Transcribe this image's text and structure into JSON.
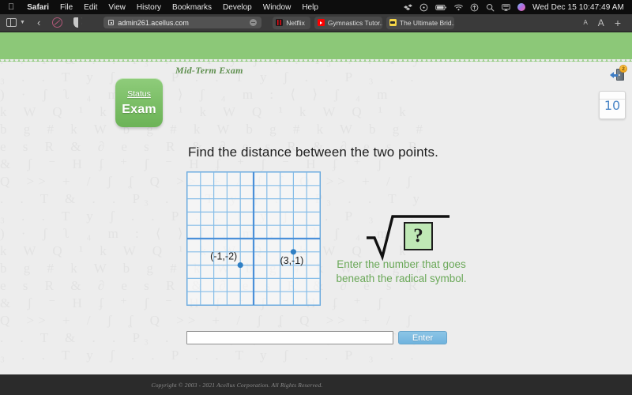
{
  "menubar": {
    "apple_icon": "apple-logo-icon",
    "items": [
      {
        "label": "Safari",
        "bold": true
      },
      {
        "label": "File",
        "bold": false
      },
      {
        "label": "Edit",
        "bold": false
      },
      {
        "label": "View",
        "bold": false
      },
      {
        "label": "History",
        "bold": false
      },
      {
        "label": "Bookmarks",
        "bold": false
      },
      {
        "label": "Develop",
        "bold": false
      },
      {
        "label": "Window",
        "bold": false
      },
      {
        "label": "Help",
        "bold": false
      }
    ],
    "status_icons": [
      "dropbox-icon",
      "timemachine-icon",
      "battery-icon",
      "wifi-icon",
      "update-icon",
      "search-icon",
      "airplay-icon",
      "siri-icon"
    ],
    "clock": "Wed Dec 15  10:47:49 AM"
  },
  "toolbar": {
    "sidebar_icon": "sidebar-icon",
    "chevron_icon": "chevron-down-icon",
    "back_icon": "back-arrow-icon",
    "extension_icon": "extension-icon",
    "privacy_icon": "privacy-shield-icon",
    "url": "admin261.acellus.com",
    "url_lock_icon": "page-settings-icon",
    "url_stop_icon": "stop-reload-icon",
    "tabs": [
      {
        "label": "Netflix",
        "favicon": "netflix-favicon"
      },
      {
        "label": "Gymnastics Tutor...",
        "favicon": "youtube-favicon"
      },
      {
        "label": "The Ultimate Brid...",
        "favicon": "bridge-favicon"
      }
    ],
    "font_small_label": "A",
    "font_large_label": "A",
    "new_tab_label": "+"
  },
  "page": {
    "exam_title": "Mid-Term Exam",
    "status_label": "Status",
    "status_value": "Exam",
    "exit_icon": "exit-door-icon",
    "exit_badge": "2",
    "counter_value": "10",
    "question": "Find the distance between the two points.",
    "radical_placeholder": "?",
    "instruction": "Enter the number that goes beneath the radical symbol.",
    "answer_value": "",
    "answer_placeholder": "",
    "enter_label": "Enter",
    "footer": "Copyright © 2003 - 2021 Acellus Corporation.  All Rights Reserved.",
    "watermark_text": "Q >> + / ʃ ʆ Q >> + / ʃ ʆ Q >> + / ʃ\n. . T & . . P₃ . . T y ʃ . . P₃ . . T y\n₃ . . T y ʃ . . P . . T y ʃ . . P ₃ . .\n) · ʃ ʅ ₄ m : ⟨ ⟩ ʃ ₄ m : ⟨ ⟩ ʃ ₄ m\nk W Q ¹ k W Q ¹ k W Q ¹ k W Q ¹ k\nb g # k W b g # k W b g # k W b g #\ne s R & ∂ e s R & ∂ e s R & ∂ e s R\n& ʃ ⁻ H ʄ ⁺ ʃ ⁻ H ʄ ⁺ ʃ ⁻ H ʄ ⁺ ʃ\nQ >> + / ʃ ʆ Q >> + / ʃ ʆ Q >> + / ʃ\n. . T & . . P₃ . . T y ʃ . . P₃ . . T y\n₃ . . T y ʃ . . P . . T y ʃ . . P ₃ . .\n) · ʃ ʅ ₄ m : ⟨ ⟩ ʃ ₄ m : ⟨ ⟩ ʃ ₄ m\nk W Q ¹ k W Q ¹ k W Q ¹ k W Q ¹ k\nb g # k W b g # k W b g # k W b g #\ne s R & ∂ e s R & ∂ e s R & ∂ e s R\n& ʃ ⁻ H ʄ ⁺ ʃ ⁻ H ʄ ⁺ ʃ ⁻ H ʄ ⁺ ʃ\nQ >> + / ʃ ʆ Q >> + / ʃ ʆ Q >> + / ʃ\n. . T & . . P₃ . . T y ʃ . . P₃ . . T y\n₃ . . T y ʃ . . P . . T y ʃ . . P ₃ . ."
  },
  "chart_data": {
    "type": "scatter",
    "title": "",
    "xlabel": "",
    "ylabel": "",
    "xlim": [
      -5,
      5
    ],
    "ylim": [
      -5,
      5
    ],
    "grid": true,
    "grid_step": 1,
    "axis_color": "#4a90d9",
    "grid_color": "#86bde8",
    "point_color": "#2f7fc4",
    "points": [
      {
        "x": -1,
        "y": -2,
        "label": "(-1,-2)",
        "label_pos": "left-above"
      },
      {
        "x": 3,
        "y": -1,
        "label": "(3,-1)",
        "label_pos": "below"
      }
    ]
  }
}
